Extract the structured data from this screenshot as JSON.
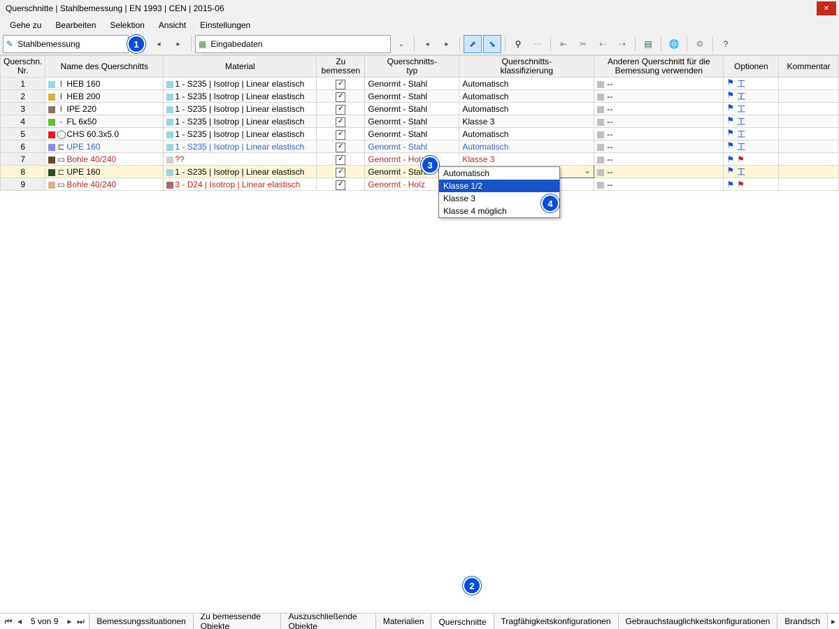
{
  "title": "Querschnitte | Stahlbemessung | EN 1993 | CEN | 2015-06",
  "menubar": [
    "Gehe zu",
    "Bearbeiten",
    "Selektion",
    "Ansicht",
    "Einstellungen"
  ],
  "toolbar": {
    "main_dropdown": "Stahlbemessung",
    "data_dropdown": "Eingabedaten"
  },
  "callouts": {
    "c1": "1",
    "c2": "2",
    "c3": "3",
    "c4": "4"
  },
  "headers": {
    "nr": "Querschn.\nNr.",
    "name": "Name des Querschnitts",
    "material": "Material",
    "check": "Zu\nbemessen",
    "type": "Querschnitts-\ntyp",
    "class": "Querschnitts-\nklassifizierung",
    "other": "Anderen Querschnitt für die\nBemessung verwenden",
    "options": "Optionen",
    "comment": "Kommentar"
  },
  "rows": [
    {
      "nr": "1",
      "sw": "#9ad6e2",
      "sect": "I",
      "name": "HEB 160",
      "msw": "#9ad6e2",
      "mat": "1 - S235 | Isotrop | Linear elastisch",
      "chk": true,
      "type": "Genormt - Stahl",
      "cls": "Automatisch",
      "other": "--",
      "style": "",
      "opt": "blue"
    },
    {
      "nr": "2",
      "sw": "#d6b14a",
      "sect": "I",
      "name": "HEB 200",
      "msw": "#9ad6e2",
      "mat": "1 - S235 | Isotrop | Linear elastisch",
      "chk": true,
      "type": "Genormt - Stahl",
      "cls": "Automatisch",
      "other": "--",
      "style": "",
      "opt": "blue"
    },
    {
      "nr": "3",
      "sw": "#8e6d6b",
      "sect": "I",
      "name": "IPE 220",
      "msw": "#9ad6e2",
      "mat": "1 - S235 | Isotrop | Linear elastisch",
      "chk": true,
      "type": "Genormt - Stahl",
      "cls": "Automatisch",
      "other": "--",
      "style": "",
      "opt": "blue"
    },
    {
      "nr": "4",
      "sw": "#5fbf3a",
      "sect": "-",
      "name": "FL 6x50",
      "msw": "#9ad6e2",
      "mat": "1 - S235 | Isotrop | Linear elastisch",
      "chk": true,
      "type": "Genormt - Stahl",
      "cls": "Klasse 3",
      "other": "--",
      "style": "",
      "opt": "blue"
    },
    {
      "nr": "5",
      "sw": "#e21f1f",
      "sect": "◯",
      "name": "CHS 60.3x5.0",
      "msw": "#9ad6e2",
      "mat": "1 - S235 | Isotrop | Linear elastisch",
      "chk": true,
      "type": "Genormt - Stahl",
      "cls": "Automatisch",
      "other": "--",
      "style": "",
      "opt": "blue"
    },
    {
      "nr": "6",
      "sw": "#8a8ae0",
      "sect": "⊏",
      "name": "UPE 160",
      "msw": "#9ad6e2",
      "mat": "1 - S235 | Isotrop | Linear elastisch",
      "chk": true,
      "type": "Genormt - Stahl",
      "cls": "Automatisch",
      "other": "--",
      "style": "blue",
      "opt": "blue"
    },
    {
      "nr": "7",
      "sw": "#6b4a2a",
      "sect": "▭",
      "name": "Bohle 40/240",
      "msw": "#d0d0d0",
      "mat": "??",
      "chk": true,
      "type": "Genormt - Holz",
      "cls": "Klasse 3",
      "other": "--",
      "style": "red",
      "opt": "red"
    },
    {
      "nr": "8",
      "sw": "#2f4f2f",
      "sect": "⊏",
      "name": "UPE 160",
      "msw": "#9ad6e2",
      "mat": "1 - S235 | Isotrop | Linear elastisch",
      "chk": true,
      "type": "Genormt - Stahl",
      "cls": "Automatisch",
      "other": "--",
      "style": "",
      "opt": "blue",
      "selected": true,
      "dropdown": true
    },
    {
      "nr": "9",
      "sw": "#d8b48a",
      "sect": "▭",
      "name": "Bohle 40/240",
      "msw": "#a96b6b",
      "mat": "3 - D24 | Isotrop | Linear elastisch",
      "chk": true,
      "type": "Genormt - Holz",
      "cls": "",
      "other": "--",
      "style": "red",
      "opt": "red"
    }
  ],
  "dropdown": {
    "display": "Automatisch",
    "options": [
      "Automatisch",
      "Klasse 1/2",
      "Klasse 3",
      "Klasse 4 möglich"
    ],
    "highlight": 1
  },
  "pager": {
    "text": "5 von 9"
  },
  "tabs": [
    "Bemessungssituationen",
    "Zu bemessende Objekte",
    "Auszuschließende Objekte",
    "Materialien",
    "Querschnitte",
    "Tragfähigkeitskonfigurationen",
    "Gebrauchstauglichkeitskonfigurationen",
    "Brandsch"
  ],
  "active_tab": 4
}
